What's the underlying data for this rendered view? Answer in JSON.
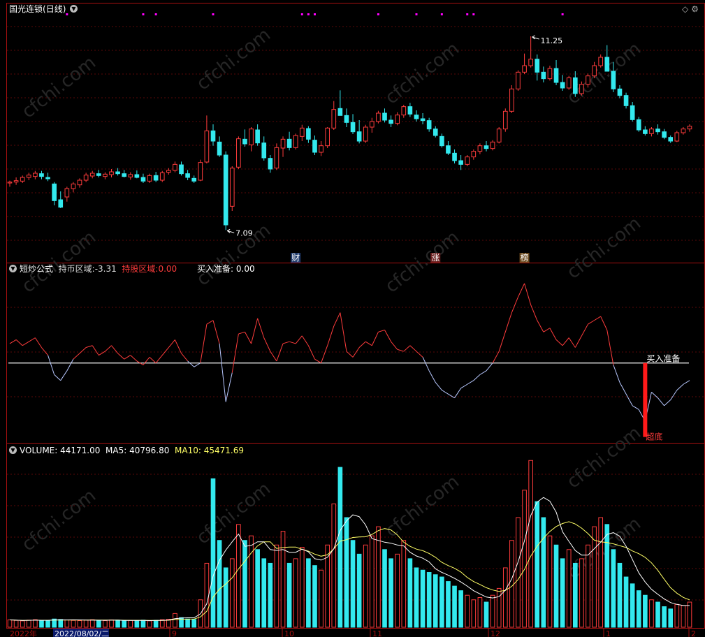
{
  "title_bar": {
    "stock_name": "国光连锁",
    "period": "(日线)"
  },
  "price_panel": {
    "high_label": "11.25",
    "low_label": "7.09",
    "event_tags": [
      "财",
      "涨",
      "榜"
    ]
  },
  "indicator_panel": {
    "name": "短炒公式",
    "hold_cash_label": "持币区域:",
    "hold_cash_value": "-3.31",
    "hold_stock_label": "持股区域:",
    "hold_stock_value": "0.00",
    "buy_ready_label": "买入准备:",
    "buy_ready_value": "0.00",
    "signal_top": "买入准备",
    "signal_bottom": "超底"
  },
  "volume_panel": {
    "volume_label": "VOLUME:",
    "volume_value": "44171.00",
    "ma5_label": "MA5:",
    "ma5_value": "40796.80",
    "ma10_label": "MA10:",
    "ma10_value": "45471.69"
  },
  "time_axis": {
    "year_label": "2022年",
    "cursor_date": "2022/08/02/二",
    "month_ticks": [
      "9",
      "10",
      "11",
      "12",
      "1",
      "2"
    ]
  },
  "watermark": "cfchi.com",
  "colors": {
    "up": "#ff3c3c",
    "down": "#33e9ee",
    "panel_border": "#a81010",
    "ma5": "#ffffff",
    "ma10": "#ffff66",
    "marker": "#ff00ff"
  },
  "chart_data": {
    "type": "candlestick",
    "candles": [
      [
        8.1,
        8.15,
        8.02,
        8.12
      ],
      [
        8.12,
        8.22,
        8.06,
        8.15
      ],
      [
        8.14,
        8.26,
        8.1,
        8.22
      ],
      [
        8.22,
        8.32,
        8.16,
        8.27
      ],
      [
        8.24,
        8.36,
        8.18,
        8.31
      ],
      [
        8.3,
        8.36,
        8.18,
        8.24
      ],
      [
        8.22,
        8.32,
        8.14,
        8.19
      ],
      [
        8.08,
        8.12,
        7.62,
        7.72
      ],
      [
        7.74,
        7.92,
        7.56,
        7.58
      ],
      [
        7.8,
        8.02,
        7.7,
        7.98
      ],
      [
        7.98,
        8.12,
        7.9,
        8.08
      ],
      [
        8.06,
        8.2,
        8.0,
        8.16
      ],
      [
        8.16,
        8.32,
        8.12,
        8.27
      ],
      [
        8.25,
        8.36,
        8.2,
        8.31
      ],
      [
        8.3,
        8.38,
        8.22,
        8.26
      ],
      [
        8.24,
        8.33,
        8.18,
        8.29
      ],
      [
        8.28,
        8.4,
        8.22,
        8.34
      ],
      [
        8.34,
        8.42,
        8.26,
        8.3
      ],
      [
        8.3,
        8.38,
        8.22,
        8.24
      ],
      [
        8.23,
        8.33,
        8.17,
        8.28
      ],
      [
        8.28,
        8.37,
        8.2,
        8.22
      ],
      [
        8.22,
        8.3,
        8.1,
        8.14
      ],
      [
        8.14,
        8.3,
        8.1,
        8.26
      ],
      [
        8.26,
        8.34,
        8.12,
        8.16
      ],
      [
        8.16,
        8.36,
        8.12,
        8.32
      ],
      [
        8.33,
        8.42,
        8.28,
        8.37
      ],
      [
        8.37,
        8.56,
        8.33,
        8.5
      ],
      [
        8.49,
        8.56,
        8.26,
        8.3
      ],
      [
        8.3,
        8.38,
        8.16,
        8.22
      ],
      [
        8.2,
        8.26,
        8.1,
        8.14
      ],
      [
        8.16,
        8.6,
        8.14,
        8.54
      ],
      [
        8.55,
        9.55,
        8.52,
        9.22
      ],
      [
        9.22,
        9.36,
        8.9,
        9.0
      ],
      [
        8.98,
        9.1,
        8.66,
        8.7
      ],
      [
        8.7,
        8.78,
        7.09,
        7.2
      ],
      [
        7.6,
        8.46,
        7.5,
        8.42
      ],
      [
        8.44,
        9.1,
        8.4,
        9.05
      ],
      [
        9.04,
        9.25,
        8.88,
        8.94
      ],
      [
        8.92,
        9.3,
        8.78,
        9.26
      ],
      [
        9.24,
        9.36,
        8.9,
        8.96
      ],
      [
        8.96,
        9.1,
        8.58,
        8.64
      ],
      [
        8.63,
        8.7,
        8.32,
        8.4
      ],
      [
        8.42,
        8.95,
        8.38,
        8.86
      ],
      [
        8.85,
        9.1,
        8.66,
        9.04
      ],
      [
        9.04,
        9.2,
        8.8,
        8.86
      ],
      [
        8.86,
        9.16,
        8.82,
        9.12
      ],
      [
        9.1,
        9.35,
        9.0,
        9.28
      ],
      [
        9.27,
        9.32,
        8.96,
        9.04
      ],
      [
        9.02,
        9.12,
        8.7,
        8.76
      ],
      [
        8.76,
        9.0,
        8.68,
        8.9
      ],
      [
        8.9,
        9.3,
        8.85,
        9.28
      ],
      [
        9.28,
        9.86,
        9.24,
        9.68
      ],
      [
        9.7,
        10.09,
        9.6,
        9.55
      ],
      [
        9.55,
        9.7,
        9.3,
        9.4
      ],
      [
        9.4,
        9.58,
        9.15,
        9.2
      ],
      [
        9.2,
        9.45,
        8.95,
        9.0
      ],
      [
        9.0,
        9.35,
        8.96,
        9.3
      ],
      [
        9.3,
        9.5,
        9.18,
        9.42
      ],
      [
        9.42,
        9.65,
        9.38,
        9.6
      ],
      [
        9.6,
        9.7,
        9.4,
        9.45
      ],
      [
        9.45,
        9.55,
        9.3,
        9.38
      ],
      [
        9.38,
        9.62,
        9.34,
        9.56
      ],
      [
        9.56,
        9.78,
        9.5,
        9.74
      ],
      [
        9.74,
        9.82,
        9.52,
        9.58
      ],
      [
        9.56,
        9.66,
        9.42,
        9.48
      ],
      [
        9.48,
        9.6,
        9.36,
        9.44
      ],
      [
        9.44,
        9.5,
        9.2,
        9.26
      ],
      [
        9.26,
        9.32,
        9.08,
        9.12
      ],
      [
        9.1,
        9.16,
        8.86,
        8.9
      ],
      [
        8.9,
        9.0,
        8.7,
        8.74
      ],
      [
        8.74,
        8.82,
        8.52,
        8.58
      ],
      [
        8.58,
        8.7,
        8.38,
        8.5
      ],
      [
        8.5,
        8.7,
        8.46,
        8.66
      ],
      [
        8.66,
        8.82,
        8.6,
        8.78
      ],
      [
        8.78,
        8.95,
        8.72,
        8.9
      ],
      [
        8.9,
        9.0,
        8.78,
        8.84
      ],
      [
        8.84,
        9.02,
        8.8,
        8.98
      ],
      [
        8.98,
        9.3,
        8.95,
        9.26
      ],
      [
        9.26,
        9.7,
        9.2,
        9.64
      ],
      [
        9.64,
        10.2,
        9.6,
        10.12
      ],
      [
        10.12,
        10.52,
        10.08,
        10.48
      ],
      [
        10.48,
        10.88,
        10.44,
        10.62
      ],
      [
        10.62,
        11.25,
        10.58,
        10.76
      ],
      [
        10.76,
        10.86,
        10.3,
        10.48
      ],
      [
        10.48,
        10.6,
        10.26,
        10.34
      ],
      [
        10.34,
        10.62,
        10.3,
        10.56
      ],
      [
        10.56,
        10.74,
        10.2,
        10.26
      ],
      [
        10.26,
        10.42,
        10.08,
        10.14
      ],
      [
        10.14,
        10.4,
        10.1,
        10.36
      ],
      [
        10.36,
        10.5,
        9.95,
        10.02
      ],
      [
        10.02,
        10.28,
        9.98,
        10.22
      ],
      [
        10.22,
        10.45,
        10.15,
        10.4
      ],
      [
        10.4,
        10.7,
        10.35,
        10.62
      ],
      [
        10.62,
        10.86,
        10.58,
        10.8
      ],
      [
        10.8,
        11.06,
        10.7,
        10.5
      ],
      [
        10.5,
        10.7,
        10.05,
        10.12
      ],
      [
        10.12,
        10.2,
        9.92,
        9.98
      ],
      [
        9.98,
        10.04,
        9.7,
        9.76
      ],
      [
        9.76,
        9.84,
        9.42,
        9.46
      ],
      [
        9.46,
        9.52,
        9.2,
        9.24
      ],
      [
        9.24,
        9.32,
        9.12,
        9.16
      ],
      [
        9.16,
        9.3,
        9.1,
        9.26
      ],
      [
        9.26,
        9.36,
        9.14,
        9.2
      ],
      [
        9.2,
        9.26,
        9.04,
        9.08
      ],
      [
        9.08,
        9.12,
        8.96,
        9.0
      ],
      [
        9.0,
        9.22,
        8.98,
        9.18
      ],
      [
        9.18,
        9.3,
        9.14,
        9.26
      ],
      [
        9.26,
        9.36,
        9.2,
        9.32
      ]
    ],
    "volume": [
      [
        3200,
        1
      ],
      [
        3000,
        1
      ],
      [
        2800,
        1
      ],
      [
        3100,
        1
      ],
      [
        3300,
        1
      ],
      [
        2900,
        0
      ],
      [
        3000,
        0
      ],
      [
        3600,
        0
      ],
      [
        3400,
        0
      ],
      [
        3200,
        1
      ],
      [
        3000,
        1
      ],
      [
        2900,
        1
      ],
      [
        3100,
        1
      ],
      [
        3300,
        1
      ],
      [
        3000,
        0
      ],
      [
        2900,
        1
      ],
      [
        3200,
        1
      ],
      [
        3100,
        0
      ],
      [
        2800,
        0
      ],
      [
        3000,
        1
      ],
      [
        2900,
        0
      ],
      [
        3100,
        0
      ],
      [
        2800,
        1
      ],
      [
        3000,
        0
      ],
      [
        3300,
        1
      ],
      [
        3500,
        1
      ],
      [
        6000,
        1
      ],
      [
        4200,
        0
      ],
      [
        3600,
        0
      ],
      [
        3400,
        0
      ],
      [
        12000,
        1
      ],
      [
        28000,
        1
      ],
      [
        65000,
        0
      ],
      [
        38000,
        0
      ],
      [
        26000,
        0
      ],
      [
        30000,
        1
      ],
      [
        45000,
        1
      ],
      [
        38000,
        0
      ],
      [
        40000,
        1
      ],
      [
        34000,
        0
      ],
      [
        30000,
        0
      ],
      [
        28000,
        0
      ],
      [
        36000,
        1
      ],
      [
        42000,
        1
      ],
      [
        28000,
        0
      ],
      [
        30000,
        1
      ],
      [
        35000,
        1
      ],
      [
        30000,
        0
      ],
      [
        27000,
        0
      ],
      [
        25000,
        1
      ],
      [
        36000,
        1
      ],
      [
        54000,
        1
      ],
      [
        70000,
        0
      ],
      [
        48000,
        0
      ],
      [
        38000,
        0
      ],
      [
        32000,
        0
      ],
      [
        36000,
        1
      ],
      [
        40000,
        1
      ],
      [
        44000,
        1
      ],
      [
        34000,
        0
      ],
      [
        30000,
        0
      ],
      [
        32000,
        1
      ],
      [
        38000,
        1
      ],
      [
        30000,
        0
      ],
      [
        26000,
        0
      ],
      [
        25000,
        0
      ],
      [
        24000,
        0
      ],
      [
        23000,
        0
      ],
      [
        22000,
        0
      ],
      [
        20000,
        0
      ],
      [
        18000,
        0
      ],
      [
        16000,
        0
      ],
      [
        14000,
        1
      ],
      [
        12000,
        1
      ],
      [
        13000,
        1
      ],
      [
        11000,
        0
      ],
      [
        14000,
        1
      ],
      [
        17000,
        1
      ],
      [
        26000,
        1
      ],
      [
        38000,
        1
      ],
      [
        48000,
        1
      ],
      [
        60000,
        1
      ],
      [
        73000,
        1
      ],
      [
        55000,
        0
      ],
      [
        48000,
        0
      ],
      [
        40000,
        1
      ],
      [
        36000,
        0
      ],
      [
        30000,
        0
      ],
      [
        34000,
        1
      ],
      [
        28000,
        0
      ],
      [
        30000,
        1
      ],
      [
        36000,
        1
      ],
      [
        44000,
        1
      ],
      [
        48000,
        1
      ],
      [
        45000,
        0
      ],
      [
        34000,
        0
      ],
      [
        28000,
        0
      ],
      [
        22000,
        0
      ],
      [
        19000,
        0
      ],
      [
        16000,
        0
      ],
      [
        14000,
        0
      ],
      [
        12000,
        1
      ],
      [
        11000,
        0
      ],
      [
        9000,
        0
      ],
      [
        8000,
        0
      ],
      [
        10000,
        1
      ],
      [
        9500,
        1
      ],
      [
        11000,
        1
      ]
    ],
    "indicator": [
      1.0,
      1.2,
      0.9,
      1.1,
      1.3,
      0.8,
      0.4,
      -0.6,
      -0.9,
      -0.4,
      0.2,
      0.5,
      0.8,
      0.9,
      0.4,
      0.6,
      0.9,
      0.5,
      0.2,
      0.4,
      0.1,
      -0.1,
      0.3,
      0.0,
      0.4,
      0.8,
      1.2,
      0.5,
      0.1,
      -0.2,
      0.0,
      2.0,
      2.2,
      1.0,
      -2.0,
      -0.5,
      1.5,
      1.6,
      1.0,
      2.3,
      1.3,
      0.6,
      0.1,
      1.0,
      1.1,
      1.0,
      1.4,
      0.9,
      0.2,
      0.0,
      0.9,
      1.9,
      2.6,
      0.6,
      0.3,
      0.8,
      1.1,
      0.9,
      1.6,
      1.7,
      1.1,
      0.7,
      0.6,
      0.9,
      0.6,
      0.3,
      -0.4,
      -1.0,
      -1.4,
      -1.6,
      -1.8,
      -1.3,
      -1.1,
      -0.9,
      -0.6,
      -0.4,
      0.0,
      0.6,
      1.6,
      2.6,
      3.4,
      4.1,
      3.0,
      2.2,
      1.6,
      1.8,
      1.2,
      0.9,
      1.3,
      0.8,
      1.4,
      2.0,
      2.2,
      2.4,
      1.7,
      -0.1,
      -1.0,
      -1.6,
      -2.2,
      -2.4,
      -3.0,
      -1.5,
      -1.8,
      -2.2,
      -1.9,
      -1.4,
      -1.1,
      -0.9
    ],
    "price_range": [
      6.6,
      11.7
    ],
    "volume_max": 74000,
    "indicator_range": [
      -3.9,
      4.6
    ],
    "signal_buy_ready": 0.0,
    "signal_super_bottom": -3.31,
    "signal_index": 100,
    "top_markers": [
      9,
      21,
      23,
      32,
      46,
      47,
      48,
      58,
      64,
      68,
      72,
      73,
      87
    ]
  }
}
